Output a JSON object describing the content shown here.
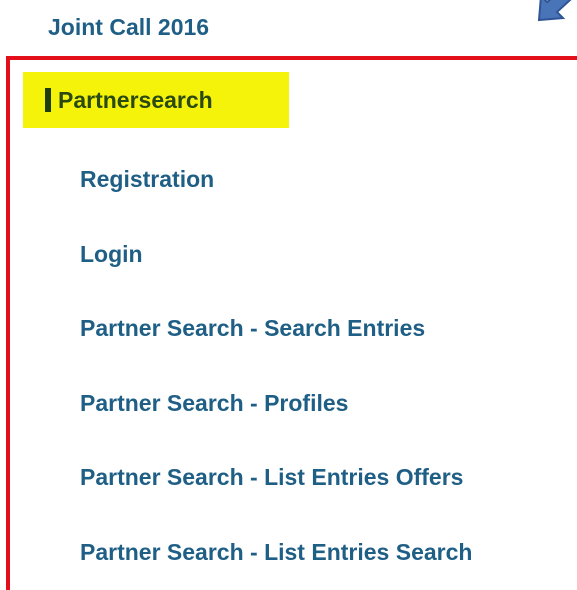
{
  "nav": {
    "parent_label": "Joint Call 2016",
    "active_label": "Partnersearch",
    "items": [
      {
        "label": "Registration"
      },
      {
        "label": "Login"
      },
      {
        "label": "Partner Search - Search Entries"
      },
      {
        "label": "Partner Search - Profiles"
      },
      {
        "label": "Partner Search - List Entries Offers"
      },
      {
        "label": "Partner Search - List Entries Search"
      }
    ]
  },
  "colors": {
    "link": "#1f5f86",
    "highlight": "#f6f30b",
    "frame": "#e3101c",
    "active_text": "#2b4a10",
    "arrow": "#4a74b8"
  },
  "icons": {
    "pointer": "arrow-down-left-icon",
    "active_marker": "active-bar-marker"
  }
}
